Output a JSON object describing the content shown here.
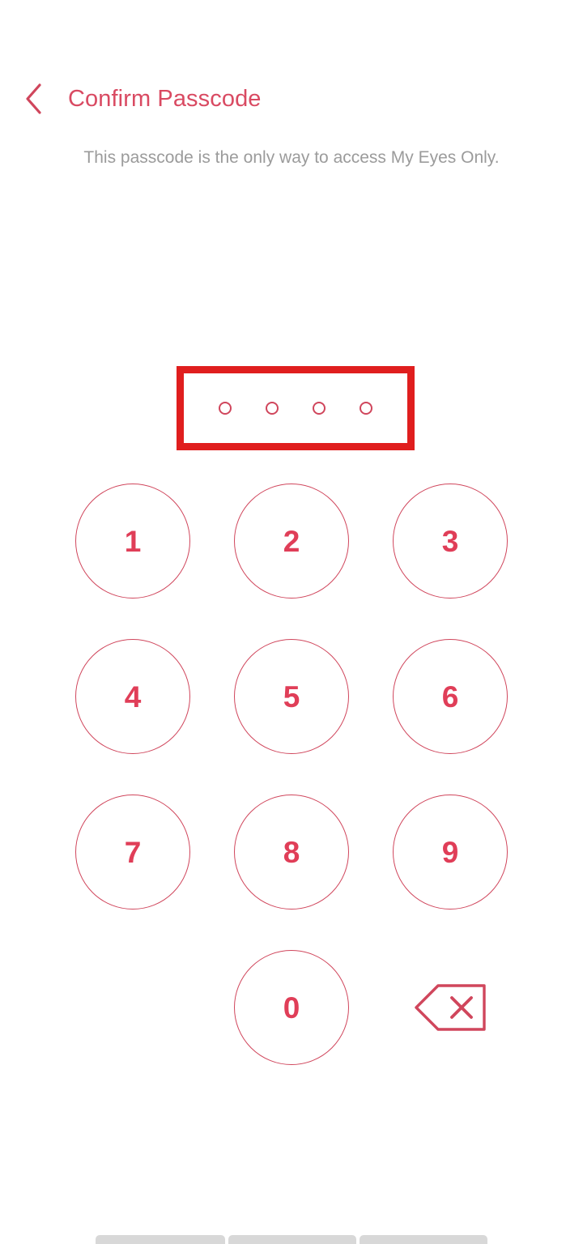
{
  "header": {
    "back_icon": "chevron-left-icon",
    "title": "Confirm Passcode"
  },
  "subtitle": "This passcode is the only way to access My Eyes Only.",
  "passcode": {
    "length": 4,
    "entered": 0,
    "dots": [
      "empty",
      "empty",
      "empty",
      "empty"
    ],
    "annotation": {
      "visible": true,
      "color": "#E01E1E",
      "stroke_px": 9
    }
  },
  "keypad": {
    "rows": [
      [
        {
          "type": "digit",
          "label": "1"
        },
        {
          "type": "digit",
          "label": "2"
        },
        {
          "type": "digit",
          "label": "3"
        }
      ],
      [
        {
          "type": "digit",
          "label": "4"
        },
        {
          "type": "digit",
          "label": "5"
        },
        {
          "type": "digit",
          "label": "6"
        }
      ],
      [
        {
          "type": "digit",
          "label": "7"
        },
        {
          "type": "digit",
          "label": "8"
        },
        {
          "type": "digit",
          "label": "9"
        }
      ],
      [
        {
          "type": "blank",
          "label": ""
        },
        {
          "type": "digit",
          "label": "0"
        },
        {
          "type": "backspace",
          "label": "",
          "icon": "backspace-delete-icon"
        }
      ]
    ]
  },
  "nav_bar": {
    "segments": [
      "recents",
      "home",
      "back"
    ]
  },
  "colors": {
    "accent": "#D0465C",
    "digit": "#E03E58",
    "title": "#D94A62",
    "subtitle": "#9b9b9b",
    "annotation": "#E01E1E",
    "nav_bar": "#D8D8D8",
    "background": "#FFFFFF"
  }
}
